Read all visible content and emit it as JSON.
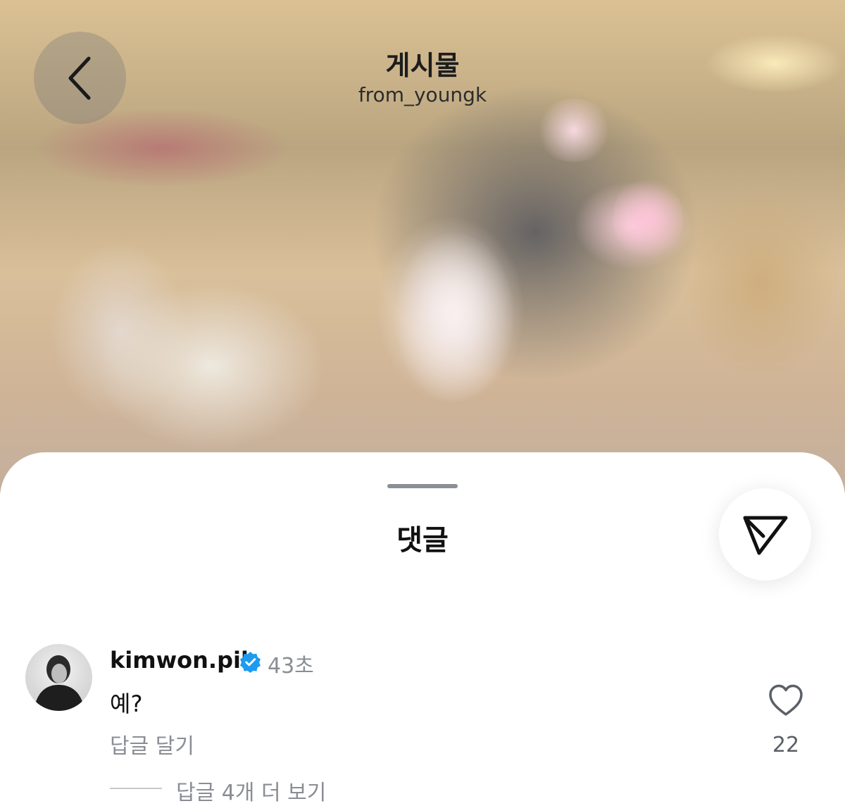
{
  "header": {
    "title": "게시물",
    "subtitle": "from_youngk"
  },
  "sheet": {
    "title": "댓글"
  },
  "comment": {
    "username": "kimwon.pil",
    "time": "43초",
    "text": "예?",
    "reply_label": "답글 달기",
    "more_replies": "답글 4개 더 보기",
    "like_count": "22"
  },
  "icons": {
    "back": "chevron-left-icon",
    "share": "send-icon",
    "verified": "verified-badge-icon",
    "like": "heart-icon"
  },
  "colors": {
    "verified": "#1d9bf0",
    "muted_text": "#8a8d93"
  }
}
